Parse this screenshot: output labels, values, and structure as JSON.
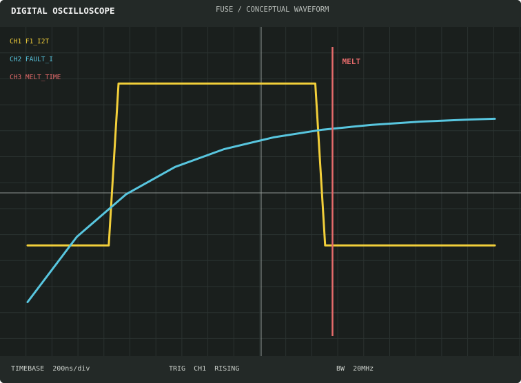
{
  "header": {
    "brand": "DIGITAL OSCILLOSCOPE",
    "subtitle": "FUSE / CONCEPTUAL WAVEFORM"
  },
  "footer": {
    "timebase": "TIMEBASE  200ns/div",
    "trigger": "TRIG  CH1  RISING",
    "bandwidth": "BW  20MHz"
  },
  "colors": {
    "background": "#1a1f1d",
    "grid": "#2b3331",
    "axis": "#8f9692",
    "ch1": "#f2cf3a",
    "ch2": "#58c6df",
    "ch3": "#e36a6a"
  },
  "chart_data": {
    "type": "line",
    "xlim": [
      0,
      10
    ],
    "ylim": [
      -4,
      4
    ],
    "grid": true,
    "legend_placement": "top-left",
    "series": [
      {
        "name": "CH1 F1_I2T",
        "color": "#f2cf3a",
        "x": [
          0,
          1.65,
          1.85,
          5.85,
          6.05,
          9.5
        ],
        "y": [
          -1.4,
          -1.4,
          2.6,
          2.6,
          -1.4,
          -1.4
        ]
      },
      {
        "name": "CH2 FAULT_I",
        "color": "#58c6df",
        "x": [
          0,
          1,
          2,
          3,
          4,
          5,
          6,
          7,
          8,
          9,
          9.5
        ],
        "y": [
          -2.8,
          -1.19,
          -0.14,
          0.54,
          0.98,
          1.27,
          1.46,
          1.58,
          1.66,
          1.71,
          1.73
        ]
      },
      {
        "name": "CH3 MELT_TIME",
        "color": "#e36a6a",
        "marker_x": 6.2,
        "marker_label": "MELT"
      }
    ]
  }
}
